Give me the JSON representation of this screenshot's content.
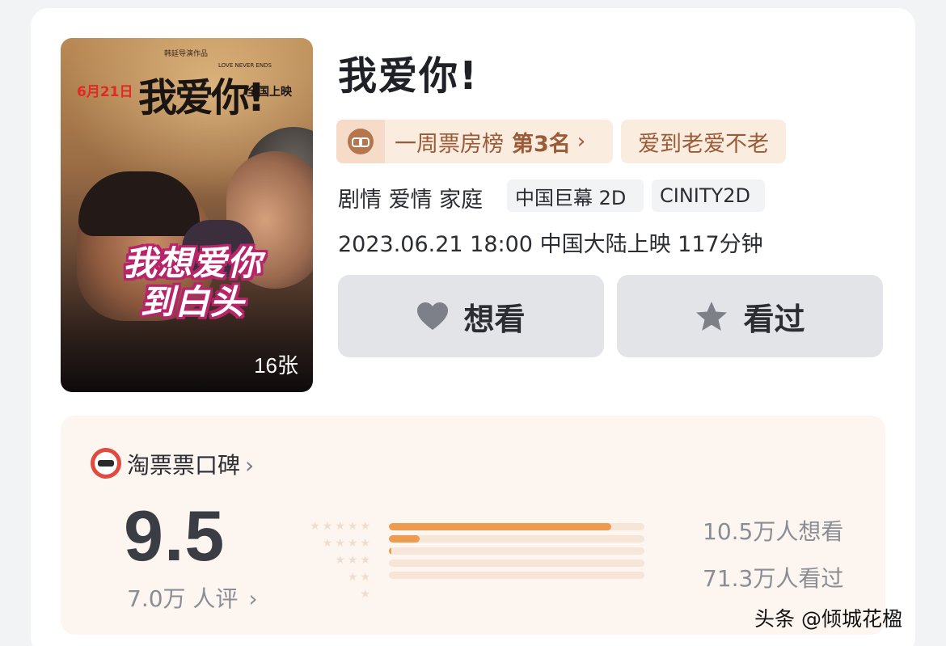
{
  "poster": {
    "date_text": "6月21日",
    "title_text": "我爱你!",
    "release_text": "全国上映",
    "director_text": "韩延导演作品",
    "english_text": "LOVE NEVER ENDS",
    "slogan_line1": "我想爱你",
    "slogan_line2": "到白头",
    "photo_count": "16张"
  },
  "movie": {
    "title": "我爱你!",
    "rank_label": "一周票房榜",
    "rank_value": "第3名",
    "rank_chevron": "›",
    "tagline": "爱到老爱不老",
    "genres": "剧情 爱情 家庭",
    "formats": [
      "中国巨幕 2D",
      "CINITY2D"
    ],
    "release_info": "2023.06.21 18:00 中国大陆上映 117分钟"
  },
  "actions": {
    "want_label": "想看",
    "seen_label": "看过"
  },
  "rating": {
    "source": "淘票票口碑",
    "score": "9.5",
    "votes": "7.0万 人评",
    "distribution": [
      {
        "stars": 5,
        "fraction": 0.87
      },
      {
        "stars": 4,
        "fraction": 0.12
      },
      {
        "stars": 3,
        "fraction": 0.01
      },
      {
        "stars": 2,
        "fraction": 0.0
      },
      {
        "stars": 1,
        "fraction": 0.0
      }
    ],
    "want_count": "10.5万人想看",
    "seen_count": "71.3万人看过"
  },
  "watermark": "头条 @倾城花楹",
  "colors": {
    "accent_brown": "#9a5b36",
    "bar_fill": "#ee9b50",
    "bar_track": "#f7e6d8",
    "button_bg": "#e3e4e8"
  }
}
